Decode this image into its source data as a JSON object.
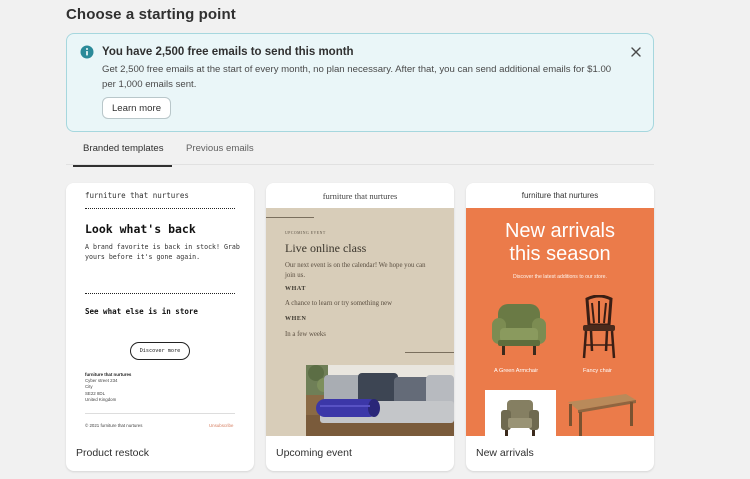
{
  "page": {
    "title": "Choose a starting point"
  },
  "banner": {
    "title": "You have 2,500 free emails to send this month",
    "body": "Get 2,500 free emails at the start of every month, no plan necessary. After that, you can send additional emails for $1.00 per 1,000 emails sent.",
    "button_label": "Learn more",
    "icon": "info-icon",
    "close_icon": "close-icon"
  },
  "tabs": [
    {
      "label": "Branded templates",
      "active": true
    },
    {
      "label": "Previous emails",
      "active": false
    }
  ],
  "templates": [
    {
      "label": "Product restock",
      "preview": {
        "brand": "furniture that nurtures",
        "headline": "Look what's back",
        "subtext": "A brand favorite is back in stock! Grab yours before it's gone again.",
        "section": "See what else is in store",
        "button": "Discover more",
        "address": [
          "furniture that nurtures",
          "Cyber street 234",
          "City",
          "SE22 8DL",
          "United Kingdom"
        ],
        "copyright": "© 2021 furniture that nurtures",
        "unsubscribe": "Unsubscribe"
      }
    },
    {
      "label": "Upcoming event",
      "preview": {
        "brand": "furniture that nurtures",
        "kicker": "UPCOMING EVENT",
        "title": "Live online class",
        "description": "Our next event is on the calendar! We hope you can join us.",
        "what_heading": "WHAT",
        "what": "A chance to learn or try something new",
        "when_heading": "WHEN",
        "when": "In a few weeks"
      }
    },
    {
      "label": "New arrivals",
      "preview": {
        "brand": "furniture that nurtures",
        "title_line1": "New arrivals",
        "title_line2": "this season",
        "subtext": "Discover the latest additions to our store.",
        "caption1": "A Green Armchair",
        "caption2": "Fancy chair"
      }
    }
  ],
  "colors": {
    "banner_bg": "#eaf6f8",
    "banner_border": "#a6d7de",
    "info_icon": "#2b8a99",
    "event_bg": "#d8cdb9",
    "arrivals_bg": "#eb7b4a"
  }
}
